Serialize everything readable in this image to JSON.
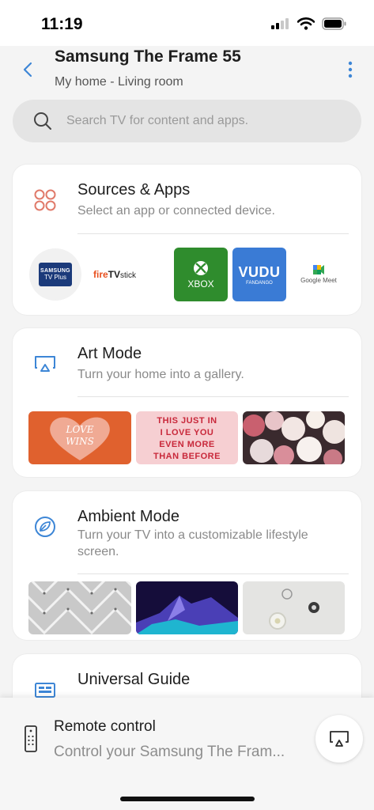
{
  "status_bar": {
    "time": "11:19"
  },
  "header": {
    "title": "Samsung The Frame 55",
    "subtitle": "My home - Living room",
    "back_icon": "chevron-left-icon",
    "more_icon": "more-vertical-icon"
  },
  "search": {
    "placeholder": "Search TV for content and apps."
  },
  "cards": {
    "sources": {
      "title": "Sources & Apps",
      "description": "Select an app or connected device.",
      "apps": {
        "samsung_line1": "SAMSUNG",
        "samsung_line2": "TV Plus",
        "firetv_a": "fire",
        "firetv_b": "TV",
        "firetv_c": "stick",
        "xbox": "XBOX",
        "vudu": "VUDU",
        "vudu_sub": "FANDANGO",
        "meet": "Google Meet"
      }
    },
    "art": {
      "title": "Art Mode",
      "description": "Turn your home into a gallery.",
      "thumb1_text_a": "LOVE",
      "thumb1_text_b": "WINS",
      "thumb2_lines": [
        "THIS JUST IN",
        "I LOVE YOU",
        "EVEN MORE",
        "THAN BEFORE"
      ]
    },
    "ambient": {
      "title": "Ambient Mode",
      "description": "Turn your TV into a customizable lifestyle screen."
    },
    "guide": {
      "title": "Universal Guide"
    }
  },
  "bottom": {
    "title": "Remote control",
    "description": "Control your Samsung The Fram..."
  },
  "colors": {
    "accent": "#3d86d6",
    "sources_icon": "#e07a6a",
    "xbox_green": "#2f8c2d",
    "vudu_blue": "#3a7bd5"
  }
}
